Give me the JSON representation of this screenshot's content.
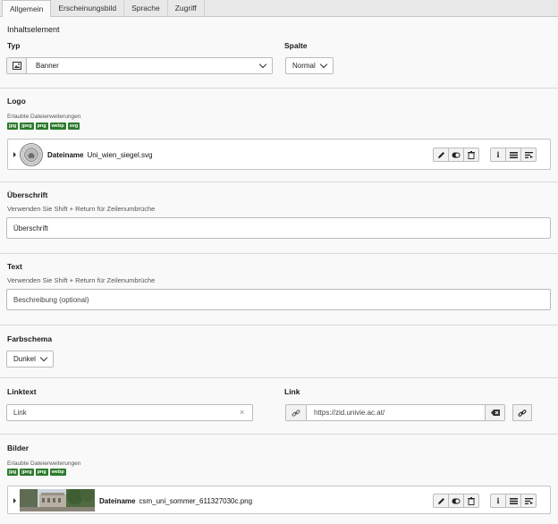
{
  "tabs": [
    {
      "label": "Allgemein",
      "active": true
    },
    {
      "label": "Erscheinungsbild",
      "active": false
    },
    {
      "label": "Sprache",
      "active": false
    },
    {
      "label": "Zugriff",
      "active": false
    }
  ],
  "content_element": {
    "heading": "Inhaltselement",
    "type_label": "Typ",
    "type_value": "Banner",
    "type_icon": "image-icon",
    "column_label": "Spalte",
    "column_value": "Normal"
  },
  "logo": {
    "title": "Logo",
    "allowed_ext_label": "Erlaubte Dateierweiterungen",
    "extensions": [
      "jpg",
      "jpeg",
      "png",
      "webp",
      "svg"
    ],
    "file_label": "Dateiname",
    "file_name": "Uni_wien_siegel.svg"
  },
  "heading_field": {
    "title": "Überschrift",
    "hint": "Verwenden Sie Shift + Return für Zeilenumbrüche",
    "value": "Überschrift"
  },
  "text_field": {
    "title": "Text",
    "hint": "Verwenden Sie Shift + Return für Zeilenumbrüche",
    "value": "Beschreibung (optional)"
  },
  "color_scheme": {
    "title": "Farbschema",
    "value": "Dunkel"
  },
  "link_text": {
    "title": "Linktext",
    "value": "Link",
    "clear_glyph": "×"
  },
  "link": {
    "title": "Link",
    "value": "https://zid.univie.ac.at/"
  },
  "images": {
    "title": "Bilder",
    "allowed_ext_label": "Erlaubte Dateierweiterungen",
    "extensions": [
      "jpg",
      "jpeg",
      "png",
      "webp"
    ],
    "file_label": "Dateiname",
    "file_name": "csm_uni_sommer_611327030c.png"
  },
  "file_actions": [
    "pencil-icon",
    "toggle-icon",
    "trash-icon",
    "info-icon",
    "menu-icon",
    "crop-icon"
  ],
  "colors": {
    "tag_green": "#2b7a2b",
    "panel_bg": "#f9f9f9",
    "border": "#bbbbbb"
  }
}
